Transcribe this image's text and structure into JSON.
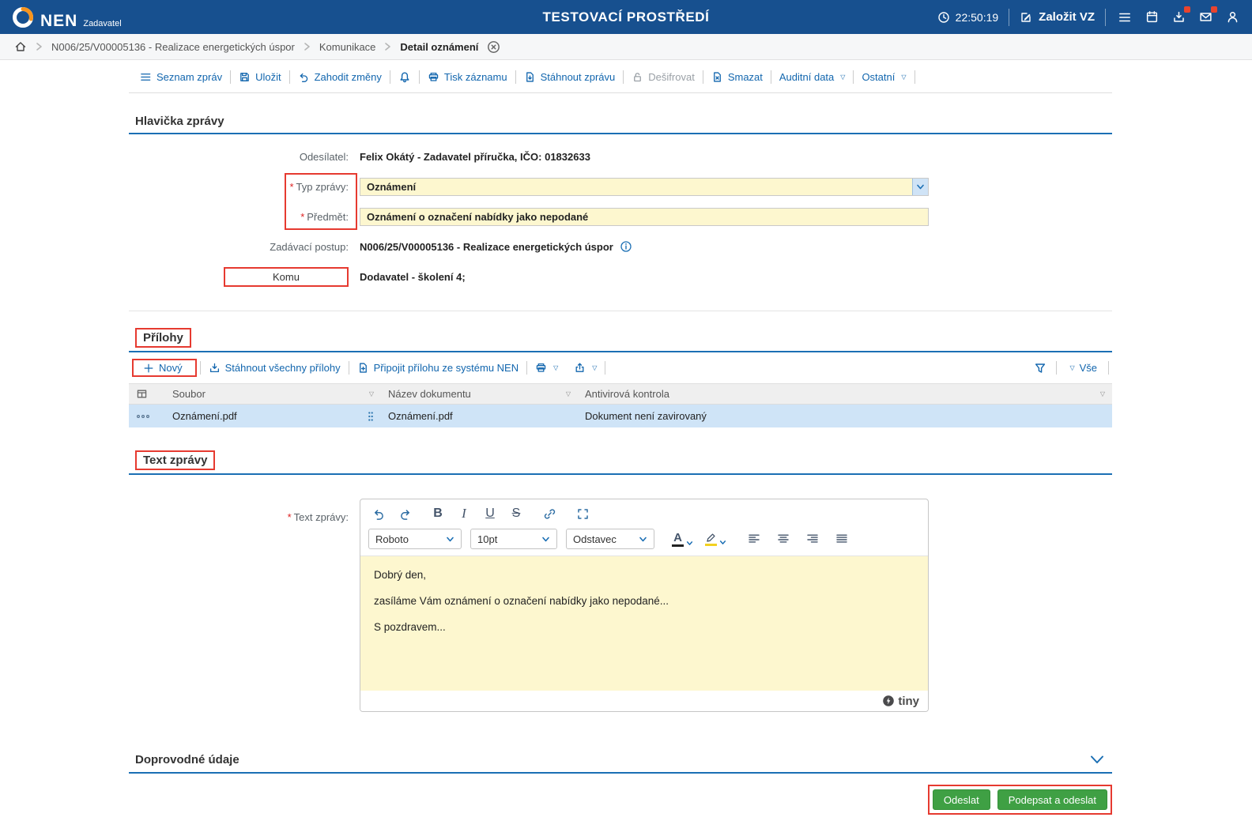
{
  "app": {
    "logo": "NEN",
    "logo_sub": "Zadavatel",
    "env_title": "TESTOVACÍ PROSTŘEDÍ",
    "time": "22:50:19",
    "create_button": "Založit VZ"
  },
  "breadcrumb": {
    "items": [
      "N006/25/V00005136 - Realizace energetických úspor",
      "Komunikace",
      "Detail oznámení"
    ]
  },
  "toolbar": {
    "list": "Seznam zpráv",
    "save": "Uložit",
    "discard": "Zahodit změny",
    "print": "Tisk záznamu",
    "download": "Stáhnout zprávu",
    "decrypt": "Dešifrovat",
    "delete": "Smazat",
    "audit": "Auditní data",
    "other": "Ostatní"
  },
  "form": {
    "section_title": "Hlavička zprávy",
    "required_marker": "*",
    "sender_label": "Odesílatel:",
    "sender_value": "Felix Okátý - Zadavatel příručka, IČO: 01832633",
    "type_label": "Typ zprávy:",
    "type_value": "Oznámení",
    "subject_label": "Předmět:",
    "subject_value": "Oznámení o označení nabídky jako nepodané",
    "procedure_label": "Zadávací postup:",
    "procedure_value": "N006/25/V00005136 - Realizace energetických úspor",
    "to_label": "Komu",
    "to_value": "Dodavatel - školení 4;"
  },
  "attachments": {
    "section_title": "Přílohy",
    "new_label": "Nový",
    "download_all_label": "Stáhnout všechny přílohy",
    "attach_from_nen_label": "Připojit přílohu ze systému NEN",
    "all_label": "Vše",
    "columns": {
      "file": "Soubor",
      "document_name": "Název dokumentu",
      "antivirus": "Antivirová kontrola"
    },
    "rows": [
      {
        "file": "Oznámení.pdf",
        "document_name": "Oznámení.pdf",
        "antivirus": "Dokument není zavirovaný"
      }
    ]
  },
  "editor": {
    "section_title": "Text zprávy",
    "field_label": "Text zprávy:",
    "font_name": "Roboto",
    "font_size": "10pt",
    "block_format": "Odstavec",
    "paragraphs": [
      "Dobrý den,",
      "zasíláme Vám oznámení o označení nabídky jako nepodané...",
      "S pozdravem..."
    ],
    "brand": "tiny"
  },
  "accompanying": {
    "section_title": "Doprovodné údaje"
  },
  "footer": {
    "send": "Odeslat",
    "sign_and_send": "Podepsat a odeslat"
  },
  "colors": {
    "header_bg": "#17508f",
    "accent_blue": "#1266ae",
    "section_rule": "#1b6fb4",
    "field_yellow": "#fdf7cf",
    "selected_row": "#cfe4f7",
    "button_green": "#3fa044",
    "annotation_red": "#e63a30"
  }
}
